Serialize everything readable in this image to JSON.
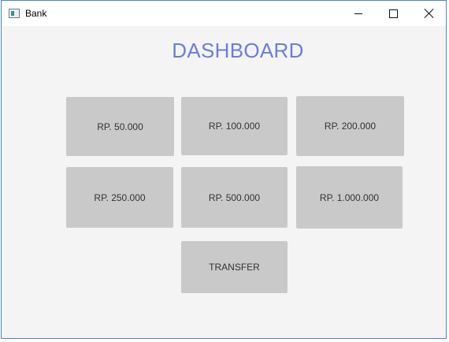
{
  "window": {
    "title": "Bank",
    "icon": "app-window-icon",
    "controls": [
      "minimize-icon",
      "maximize-icon",
      "close-icon"
    ]
  },
  "main": {
    "heading": "DASHBOARD",
    "buttons": [
      {
        "label": "RP. 50.000"
      },
      {
        "label": "RP. 100.000"
      },
      {
        "label": "RP. 200.000"
      },
      {
        "label": "RP. 250.000"
      },
      {
        "label": "RP. 500.000"
      },
      {
        "label": "RP. 1.000.000"
      },
      {
        "label": "TRANSFER"
      }
    ]
  },
  "colors": {
    "heading": "#6a7fd6",
    "button_bg": "#c9c9c9",
    "window_bg": "#f4f4f4",
    "window_border": "#4a87c8"
  }
}
